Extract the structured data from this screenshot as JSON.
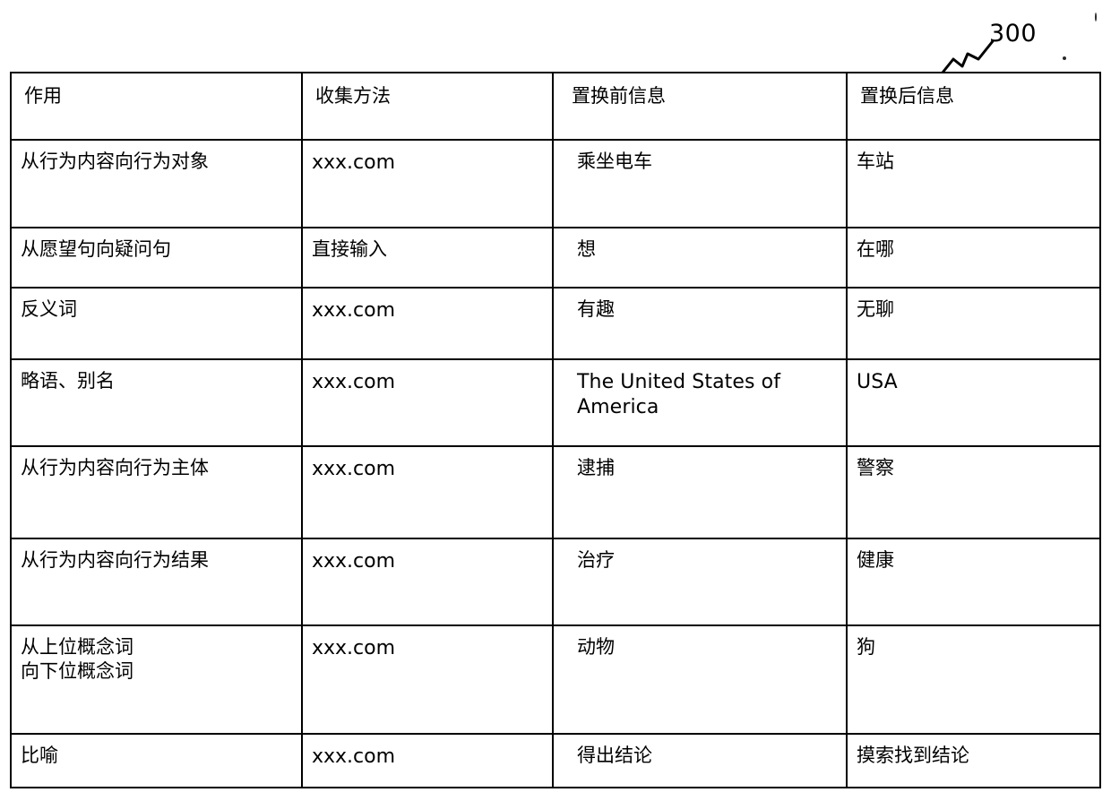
{
  "figure": {
    "reference_number": "300",
    "leader_icon": "zigzag-leader-line"
  },
  "table": {
    "columns": [
      {
        "key": "role",
        "header": "作用"
      },
      {
        "key": "method",
        "header": "收集方法"
      },
      {
        "key": "before",
        "header": "置换前信息"
      },
      {
        "key": "after",
        "header": "置换后信息"
      }
    ],
    "rows": [
      {
        "role": "从行为内容向行为对象",
        "method": "xxx.com",
        "before": "乘坐电车",
        "after": "车站"
      },
      {
        "role": "从愿望句向疑问句",
        "method": "直接输入",
        "before": "想",
        "after": "在哪"
      },
      {
        "role": "反义词",
        "method": "xxx.com",
        "before": "有趣",
        "after": "无聊"
      },
      {
        "role": "略语、别名",
        "method": "xxx.com",
        "before": "The United States of America",
        "after": "USA"
      },
      {
        "role": "从行为内容向行为主体",
        "method": "xxx.com",
        "before": "逮捕",
        "after": "警察"
      },
      {
        "role": "从行为内容向行为结果",
        "method": "xxx.com",
        "before": "治疗",
        "after": "健康"
      },
      {
        "role": "从上位概念词\n向下位概念词",
        "method": "xxx.com",
        "before": "动物",
        "after": "狗"
      },
      {
        "role": "比喻",
        "method": "xxx.com",
        "before": "得出结论",
        "after": "摸索找到结论"
      }
    ]
  },
  "colors": {
    "ink": "#000000",
    "paper": "#ffffff"
  }
}
